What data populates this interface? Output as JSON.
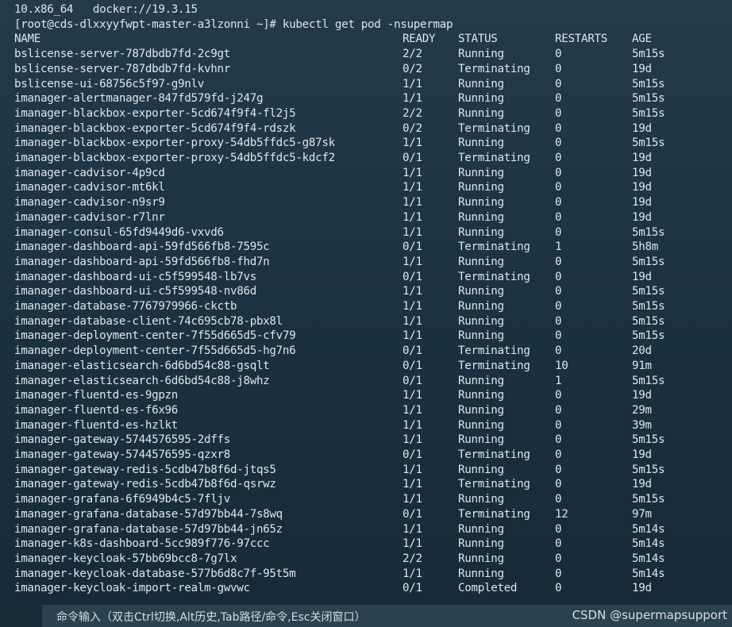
{
  "terminal": {
    "header_line": "10.x86_64   docker://19.3.15",
    "prompt": "[root@cds-dlxxyyfwpt-master-a3lzonni ~]# kubectl get pod -nsupermap",
    "columns": {
      "name": "NAME",
      "ready": "READY",
      "status": "STATUS",
      "restarts": "RESTARTS",
      "age": "AGE"
    },
    "pods": [
      {
        "name": "bslicense-server-787dbdb7fd-2c9gt",
        "ready": "2/2",
        "status": "Running",
        "restarts": "0",
        "age": "5m15s"
      },
      {
        "name": "bslicense-server-787dbdb7fd-kvhnr",
        "ready": "0/2",
        "status": "Terminating",
        "restarts": "0",
        "age": "19d"
      },
      {
        "name": "bslicense-ui-68756c5f97-g9nlv",
        "ready": "1/1",
        "status": "Running",
        "restarts": "0",
        "age": "5m15s"
      },
      {
        "name": "imanager-alertmanager-847fd579fd-j247g",
        "ready": "1/1",
        "status": "Running",
        "restarts": "0",
        "age": "5m15s"
      },
      {
        "name": "imanager-blackbox-exporter-5cd674f9f4-fl2j5",
        "ready": "2/2",
        "status": "Running",
        "restarts": "0",
        "age": "5m15s"
      },
      {
        "name": "imanager-blackbox-exporter-5cd674f9f4-rdszk",
        "ready": "0/2",
        "status": "Terminating",
        "restarts": "0",
        "age": "19d"
      },
      {
        "name": "imanager-blackbox-exporter-proxy-54db5ffdc5-g87sk",
        "ready": "1/1",
        "status": "Running",
        "restarts": "0",
        "age": "5m15s"
      },
      {
        "name": "imanager-blackbox-exporter-proxy-54db5ffdc5-kdcf2",
        "ready": "0/1",
        "status": "Terminating",
        "restarts": "0",
        "age": "19d"
      },
      {
        "name": "imanager-cadvisor-4p9cd",
        "ready": "1/1",
        "status": "Running",
        "restarts": "0",
        "age": "19d"
      },
      {
        "name": "imanager-cadvisor-mt6kl",
        "ready": "1/1",
        "status": "Running",
        "restarts": "0",
        "age": "19d"
      },
      {
        "name": "imanager-cadvisor-n9sr9",
        "ready": "1/1",
        "status": "Running",
        "restarts": "0",
        "age": "19d"
      },
      {
        "name": "imanager-cadvisor-r7lnr",
        "ready": "1/1",
        "status": "Running",
        "restarts": "0",
        "age": "19d"
      },
      {
        "name": "imanager-consul-65fd9449d6-vxvd6",
        "ready": "1/1",
        "status": "Running",
        "restarts": "0",
        "age": "5m15s"
      },
      {
        "name": "imanager-dashboard-api-59fd566fb8-7595c",
        "ready": "0/1",
        "status": "Terminating",
        "restarts": "1",
        "age": "5h8m"
      },
      {
        "name": "imanager-dashboard-api-59fd566fb8-fhd7n",
        "ready": "1/1",
        "status": "Running",
        "restarts": "0",
        "age": "5m15s"
      },
      {
        "name": "imanager-dashboard-ui-c5f599548-lb7vs",
        "ready": "0/1",
        "status": "Terminating",
        "restarts": "0",
        "age": "19d"
      },
      {
        "name": "imanager-dashboard-ui-c5f599548-nv86d",
        "ready": "1/1",
        "status": "Running",
        "restarts": "0",
        "age": "5m15s"
      },
      {
        "name": "imanager-database-7767979966-ckctb",
        "ready": "1/1",
        "status": "Running",
        "restarts": "0",
        "age": "5m15s"
      },
      {
        "name": "imanager-database-client-74c695cb78-pbx8l",
        "ready": "1/1",
        "status": "Running",
        "restarts": "0",
        "age": "5m15s"
      },
      {
        "name": "imanager-deployment-center-7f55d665d5-cfv79",
        "ready": "1/1",
        "status": "Running",
        "restarts": "0",
        "age": "5m15s"
      },
      {
        "name": "imanager-deployment-center-7f55d665d5-hg7n6",
        "ready": "0/1",
        "status": "Terminating",
        "restarts": "0",
        "age": "20d"
      },
      {
        "name": "imanager-elasticsearch-6d6bd54c88-gsqlt",
        "ready": "0/1",
        "status": "Terminating",
        "restarts": "10",
        "age": "91m"
      },
      {
        "name": "imanager-elasticsearch-6d6bd54c88-j8whz",
        "ready": "0/1",
        "status": "Running",
        "restarts": "1",
        "age": "5m15s"
      },
      {
        "name": "imanager-fluentd-es-9gpzn",
        "ready": "1/1",
        "status": "Running",
        "restarts": "0",
        "age": "19d"
      },
      {
        "name": "imanager-fluentd-es-f6x96",
        "ready": "1/1",
        "status": "Running",
        "restarts": "0",
        "age": "29m"
      },
      {
        "name": "imanager-fluentd-es-hzlkt",
        "ready": "1/1",
        "status": "Running",
        "restarts": "0",
        "age": "39m"
      },
      {
        "name": "imanager-gateway-5744576595-2dffs",
        "ready": "1/1",
        "status": "Running",
        "restarts": "0",
        "age": "5m15s"
      },
      {
        "name": "imanager-gateway-5744576595-qzxr8",
        "ready": "0/1",
        "status": "Terminating",
        "restarts": "0",
        "age": "19d"
      },
      {
        "name": "imanager-gateway-redis-5cdb47b8f6d-jtqs5",
        "ready": "1/1",
        "status": "Running",
        "restarts": "0",
        "age": "5m15s"
      },
      {
        "name": "imanager-gateway-redis-5cdb47b8f6d-qsrwz",
        "ready": "1/1",
        "status": "Terminating",
        "restarts": "0",
        "age": "19d"
      },
      {
        "name": "imanager-grafana-6f6949b4c5-7fljv",
        "ready": "1/1",
        "status": "Running",
        "restarts": "0",
        "age": "5m15s"
      },
      {
        "name": "imanager-grafana-database-57d97bb44-7s8wq",
        "ready": "0/1",
        "status": "Terminating",
        "restarts": "12",
        "age": "97m"
      },
      {
        "name": "imanager-grafana-database-57d97bb44-jn65z",
        "ready": "1/1",
        "status": "Running",
        "restarts": "0",
        "age": "5m14s"
      },
      {
        "name": "imanager-k8s-dashboard-5cc989f776-97ccc",
        "ready": "1/1",
        "status": "Running",
        "restarts": "0",
        "age": "5m14s"
      },
      {
        "name": "imanager-keycloak-57bb69bcc8-7g7lx",
        "ready": "2/2",
        "status": "Running",
        "restarts": "0",
        "age": "5m14s"
      },
      {
        "name": "imanager-keycloak-database-577b6d8c7f-95t5m",
        "ready": "1/1",
        "status": "Running",
        "restarts": "0",
        "age": "5m14s"
      },
      {
        "name": "imanager-keycloak-import-realm-gwvwc",
        "ready": "0/1",
        "status": "Completed",
        "restarts": "0",
        "age": "19d"
      }
    ]
  },
  "cmdbar": {
    "hint": "命令输入（双击Ctrl切换,Alt历史,Tab路径/命令,Esc关闭窗口）"
  },
  "watermark": "CSDN @supermapsupport"
}
